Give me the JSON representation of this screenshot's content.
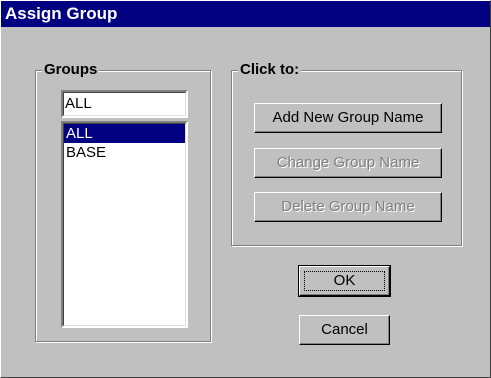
{
  "window": {
    "title": "Assign Group"
  },
  "groups_panel": {
    "label": "Groups",
    "combo_value": "ALL",
    "list_items": [
      "ALL",
      "BASE"
    ],
    "selected_index": 0
  },
  "actions_panel": {
    "label": "Click to:",
    "add_label": "Add New Group Name",
    "change_label": "Change Group Name",
    "delete_label": "Delete Group Name"
  },
  "buttons": {
    "ok_label": "OK",
    "cancel_label": "Cancel"
  },
  "colors": {
    "title_bar": "#000080",
    "face": "#c0c0c0",
    "selection": "#000080",
    "disabled_text": "#808080"
  }
}
